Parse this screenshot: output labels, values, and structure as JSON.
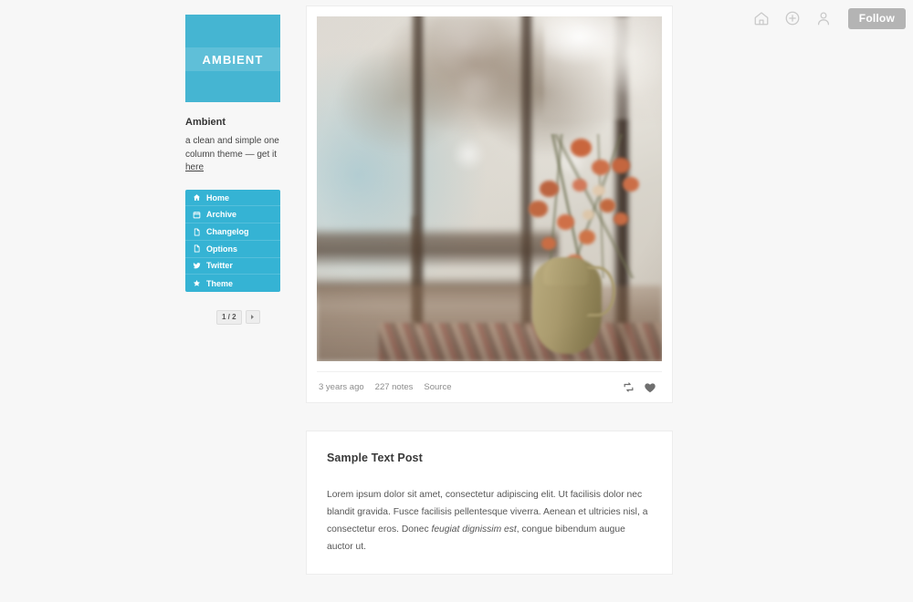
{
  "topbar": {
    "icons": [
      {
        "name": "home-icon",
        "label": "Home"
      },
      {
        "name": "plus-circle-icon",
        "label": "Create post"
      },
      {
        "name": "account-icon",
        "label": "Account"
      }
    ],
    "follow_label": "Follow"
  },
  "sidebar": {
    "avatar_text": "AMBIENT",
    "avatar_color": "#45b5d2",
    "blog_title": "Ambient",
    "description_prefix": "a clean and simple one column theme — get it ",
    "description_link": "here",
    "nav_color": "#35b3d4",
    "nav": [
      {
        "icon": "home-icon",
        "label": "Home"
      },
      {
        "icon": "calendar-icon",
        "label": "Archive"
      },
      {
        "icon": "file-icon",
        "label": "Changelog"
      },
      {
        "icon": "file-icon",
        "label": "Options"
      },
      {
        "icon": "twitter-icon",
        "label": "Twitter"
      },
      {
        "icon": "star-icon",
        "label": "Theme"
      }
    ],
    "pagination": {
      "current": "1 / 2",
      "next_label": "Next page"
    }
  },
  "posts": [
    {
      "type": "photo",
      "image_alt": "Soft-focus photo of orange carnations in a ceramic pitcher on a patterned tablecloth beside a bright window with a wooden chair",
      "meta": {
        "timestamp": "3 years ago",
        "notes": "227 notes",
        "source": "Source",
        "reblog_icon": "reblog-icon",
        "like_icon": "heart-icon"
      }
    },
    {
      "type": "text",
      "title": "Sample Text Post",
      "body_part1": "Lorem ipsum dolor sit amet, consectetur adipiscing elit. Ut facilisis dolor nec blandit gravida. Fusce facilisis pellentesque viverra. Aenean et ultricies nisl, a consectetur eros. Donec ",
      "body_italic": "feugiat dignissim est",
      "body_part2": ", congue bibendum augue auctor ut."
    }
  ]
}
